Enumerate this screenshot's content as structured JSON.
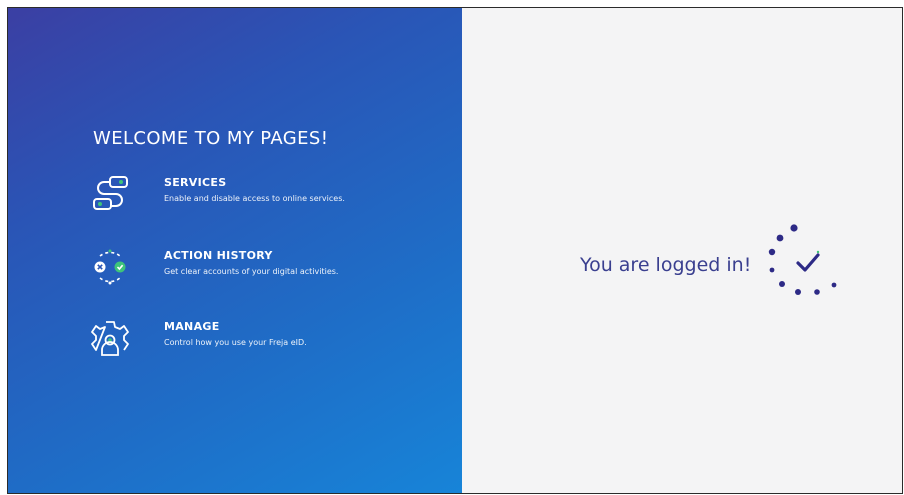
{
  "welcome": {
    "title": "WELCOME TO MY PAGES!"
  },
  "features": [
    {
      "icon": "services-icon",
      "title": "SERVICES",
      "description": "Enable and disable access to online services."
    },
    {
      "icon": "action-history-icon",
      "title": "ACTION HISTORY",
      "description": "Get clear accounts of your digital activities."
    },
    {
      "icon": "manage-icon",
      "title": "MANAGE",
      "description": "Control how you use your Freja eID."
    }
  ],
  "status": {
    "message": "You are logged in!",
    "icon": "check-spinner-icon"
  },
  "colors": {
    "gradient_start": "#3b3fa3",
    "gradient_end": "#1784d8",
    "accent_green": "#3ec47a",
    "status_text": "#3a3f8f",
    "right_bg": "#f4f4f5"
  }
}
